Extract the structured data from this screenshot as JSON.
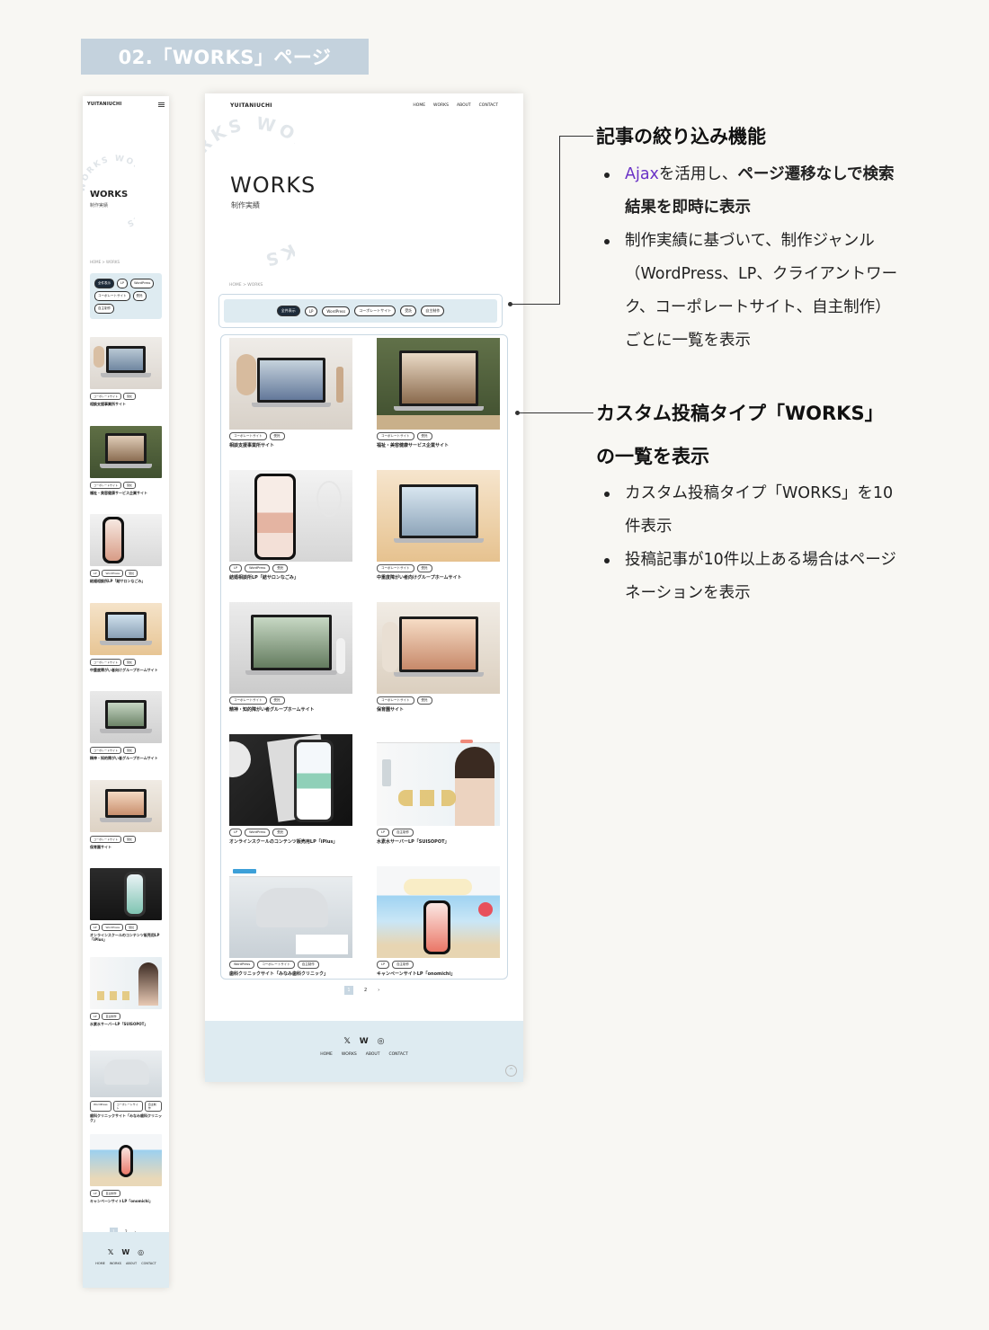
{
  "page_title": "02.「WORKS」ページ",
  "site": {
    "logo": "YUITANIUCHI",
    "nav": [
      "HOME",
      "WORKS",
      "ABOUT",
      "CONTACT"
    ],
    "hero_title": "WORKS",
    "hero_sub": "制作実績",
    "ring_text": "WORKS WORKS WORKS ",
    "breadcrumb": "HOME  >  WORKS",
    "filters": [
      "全件表示",
      "LP",
      "WordPress",
      "コーポレートサイト",
      "受託",
      "自主制作"
    ],
    "pager": [
      "1",
      "2",
      "›"
    ],
    "social": [
      "𝕏",
      "W",
      "◎"
    ],
    "top_button": "^"
  },
  "works": [
    {
      "title": "相談支援事業所サイト",
      "tags": [
        "コーポレートサイト",
        "受託"
      ]
    },
    {
      "title": "福祉・美容健康サービス企業サイト",
      "tags": [
        "コーポレートサイト",
        "受託"
      ]
    },
    {
      "title": "結婚相談所LP「結サロンなごみ」",
      "tags": [
        "LP",
        "WordPress",
        "受託"
      ]
    },
    {
      "title": "中重度障がい者向けグループホームサイト",
      "tags": [
        "コーポレートサイト",
        "受託"
      ]
    },
    {
      "title": "精神・知的障がい者グループホームサイト",
      "tags": [
        "コーポレートサイト",
        "受託"
      ]
    },
    {
      "title": "保育園サイト",
      "tags": [
        "コーポレートサイト",
        "受託"
      ]
    },
    {
      "title": "オンラインスクールのコンテンツ販売用LP「iPlus」",
      "tags": [
        "LP",
        "WordPress",
        "受託"
      ]
    },
    {
      "title": "水素水サーバーLP「SUISOPOT」",
      "tags": [
        "LP",
        "自主制作"
      ]
    },
    {
      "title": "歯科クリニックサイト「みなみ歯科クリニック」",
      "tags": [
        "WordPress",
        "コーポレートサイト",
        "自主制作"
      ]
    },
    {
      "title": "キャンペーンサイトLP「onomichi」",
      "tags": [
        "LP",
        "自主制作"
      ]
    }
  ],
  "mobile_caption_9": "歯科クリニックサイト「みなみ歯科クリニック」",
  "annotations": {
    "filter_heading": "記事の絞り込み機能",
    "filter_b1_hl": "Ajax",
    "filter_b1_mid": "を活用し、",
    "filter_b1_bold": "ページ遷移なしで検索",
    "filter_b1_bold2": "結果を即時に表示",
    "filter_b2_l1": "制作実績に基づいて、制作ジャンル",
    "filter_b2_l2": "（WordPress、LP、クライアントワー",
    "filter_b2_l3": "ク、コーポレートサイト、自主制作）",
    "filter_b2_l4": "ごとに一覧を表示",
    "list_heading_l1": "カスタム投稿タイプ「WORKS」",
    "list_heading_l2": "の一覧を表示",
    "list_b1_l1": "カスタム投稿タイプ「WORKS」を10",
    "list_b1_l2": "件表示",
    "list_b2_l1": "投稿記事が10件以上ある場合はページ",
    "list_b2_l2": "ネーションを表示"
  }
}
